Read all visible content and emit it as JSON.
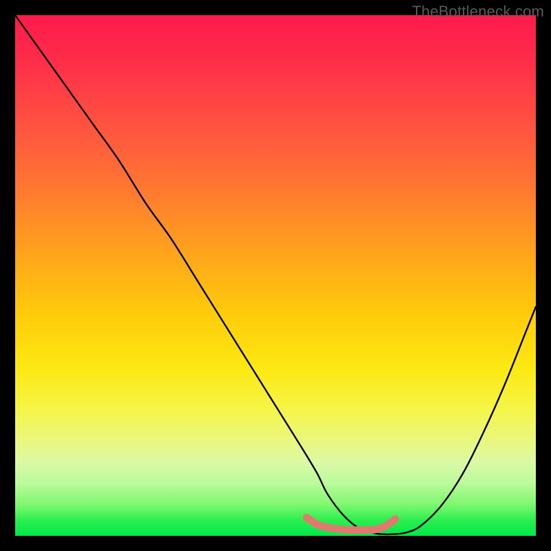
{
  "watermark": "TheBottleneck.com",
  "chart_data": {
    "type": "line",
    "title": "",
    "xlabel": "",
    "ylabel": "",
    "xlim": [
      0,
      100
    ],
    "ylim": [
      0,
      100
    ],
    "grid": false,
    "legend": false,
    "series": [
      {
        "name": "bottleneck-curve",
        "x": [
          0,
          5,
          10,
          15,
          20,
          25,
          30,
          35,
          40,
          45,
          50,
          55,
          58,
          60,
          63,
          66,
          69,
          71,
          72,
          75,
          78,
          82,
          86,
          90,
          94,
          98,
          100
        ],
        "values": [
          100,
          93,
          86,
          79,
          72,
          64,
          57,
          49,
          41,
          33,
          25,
          17,
          12,
          8,
          4,
          1.5,
          0.5,
          0.3,
          0.3,
          0.6,
          2,
          6,
          12,
          20,
          29,
          39,
          44
        ]
      },
      {
        "name": "optimal-range",
        "x": [
          56,
          58,
          60,
          63,
          66,
          69,
          71,
          73
        ],
        "values": [
          3.5,
          2.2,
          1.6,
          1.2,
          1.1,
          1.2,
          1.8,
          3.2
        ]
      }
    ],
    "background_gradient": {
      "top": "#ff1a4d",
      "mid_upper": "#ff7a30",
      "mid": "#ffcd0a",
      "mid_lower": "#f5f54a",
      "bottom": "#00e84a"
    },
    "highlight_color": "#e07a6f",
    "curve_color": "#000000"
  }
}
